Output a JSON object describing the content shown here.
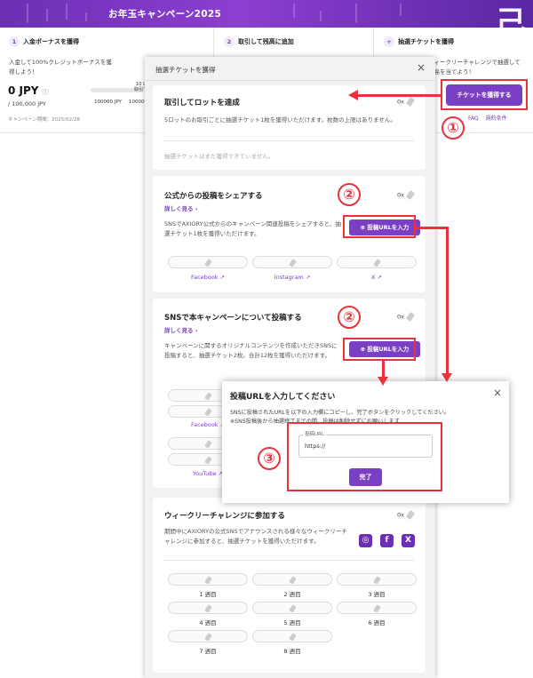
{
  "banner": {
    "title": "お年玉キャンペーン2025"
  },
  "steps": [
    {
      "num": "1",
      "label": "入金ボーナスを獲得"
    },
    {
      "num": "2",
      "label": "取引して残高に追加"
    },
    {
      "num": "+",
      "label": "抽選チケットを獲得"
    }
  ],
  "step1": {
    "desc": "入金して100%クレジットボーナスを獲得しよう！",
    "amount": "0 JPY",
    "target": "/ 100,000 JPY",
    "bar_lbl1": "100000 JPY",
    "bar_lbl2": "100000",
    "badge": "10 L",
    "badge2": "取引で",
    "period": "キャンペーン期間：2025/02/28"
  },
  "step3": {
    "desc": "ウィークリーチャレンジで抽選して残高を当てよう！",
    "get_ticket": "チケットを獲得する",
    "faq": "FAQ",
    "terms": "規約条件"
  },
  "modal": {
    "title": "抽選チケットを獲得",
    "close": "×",
    "card1": {
      "title": "取引してロットを達成",
      "count": "0x",
      "desc": "5ロットのお取引ごとに抽選チケット1枚を獲得いただけます。枚数の上限はありません。",
      "note": "抽選チケットはまだ獲得できていません。"
    },
    "card2": {
      "title": "公式からの投稿をシェアする",
      "more": "詳しく見る ›",
      "count": "0x",
      "desc": "SNSでAXIORY公式からのキャンペーン関連投稿をシェアすると、抽選チケット1枚を獲得いただけます。",
      "btn": "⊕ 投稿URLを入力",
      "links": [
        "Facebook ↗",
        "Instagram ↗",
        "X ↗"
      ]
    },
    "card3": {
      "title": "SNSで本キャンペーンについて投稿する",
      "more": "詳しく見る ›",
      "count": "0x",
      "desc": "キャンペーンに関するオリジナルコンテンツを作成いただきSNSに投稿すると、抽選チケット2枚。合計12枚を獲得いただけます。",
      "btn": "⊕ 投稿URLを入力",
      "links": [
        "Facebook ↗",
        "YouTube ↗"
      ]
    },
    "card4": {
      "title": "ウィークリーチャレンジに参加する",
      "count": "0x",
      "desc": "期間中にAXIORYの公式SNSでアナウンスされる様々なウィークリーチャレンジに参加すると、抽選チケットを獲得いただけます。",
      "weeks": [
        "1 週目",
        "2 週目",
        "3 週目",
        "4 週目",
        "5 週目",
        "6 週目",
        "7 週目",
        "8 週目"
      ],
      "icons": [
        "instagram-icon",
        "facebook-icon",
        "x-icon"
      ]
    }
  },
  "url_modal": {
    "title": "投稿URLを入力してください",
    "close": "×",
    "desc1": "SNSに投稿されたURLを以下の入力欄にコピーし、完了ボタンをクリックしてください。",
    "desc2": "※SNS投稿後から抽選終了までの間、投稿は削除せずにお願いします",
    "input_label": "投稿URL",
    "input_value": "https://",
    "done": "完了"
  },
  "annotations": {
    "c1": "①",
    "c2a": "②",
    "c2b": "②",
    "c3": "③"
  },
  "colors": {
    "brand": "#7b3fc6",
    "annotation": "#e8323c"
  }
}
